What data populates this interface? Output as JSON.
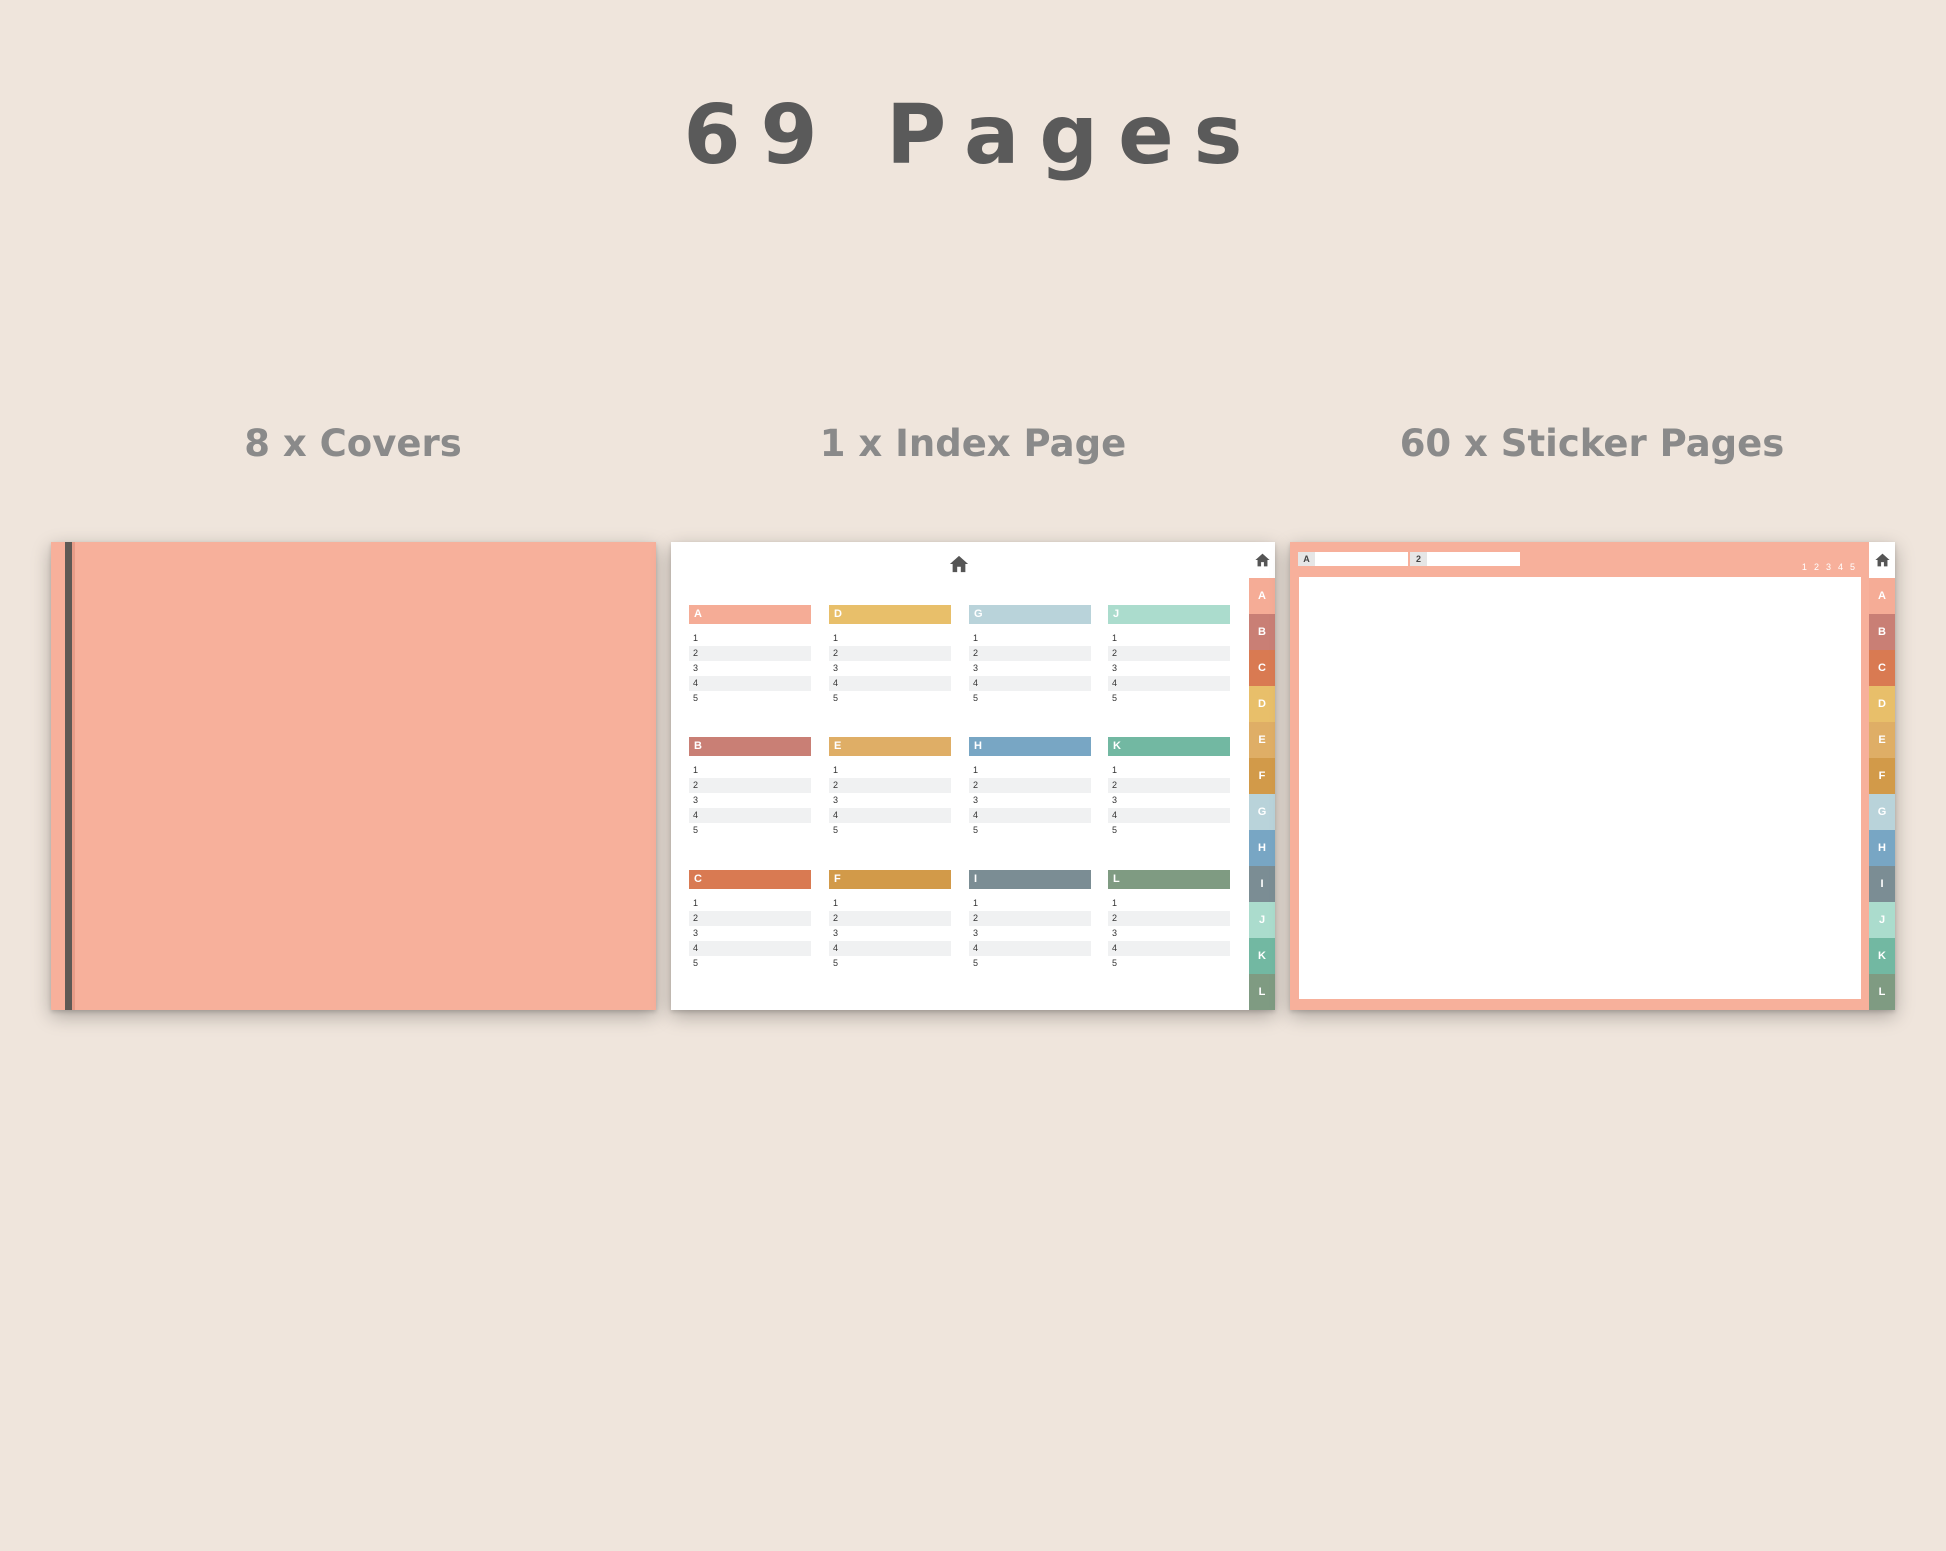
{
  "title": "69 Pages",
  "captions": {
    "covers": "8 x Covers",
    "index": "1 x Index Page",
    "stickers": "60 x Sticker Pages"
  },
  "colors": {
    "background": "#efe5dc",
    "cover": "#f7b09b",
    "row_shade": "#f0f1f2"
  },
  "icons": {
    "home": "home-icon"
  },
  "tabs": [
    {
      "label": "A",
      "color": "#f5ac96"
    },
    {
      "label": "B",
      "color": "#c97f75"
    },
    {
      "label": "C",
      "color": "#d97a52"
    },
    {
      "label": "D",
      "color": "#e8bf6a"
    },
    {
      "label": "E",
      "color": "#dfae66"
    },
    {
      "label": "F",
      "color": "#d29a49"
    },
    {
      "label": "G",
      "color": "#b9d3da"
    },
    {
      "label": "H",
      "color": "#78a6c4"
    },
    {
      "label": "I",
      "color": "#7b8d94"
    },
    {
      "label": "J",
      "color": "#abdccd"
    },
    {
      "label": "K",
      "color": "#72b8a2"
    },
    {
      "label": "L",
      "color": "#7f9b82"
    }
  ],
  "index": {
    "row_numbers": [
      "1",
      "2",
      "3",
      "4",
      "5"
    ]
  },
  "sticker": {
    "field_keys": [
      "A",
      "2"
    ],
    "page_numbers": [
      "1",
      "2",
      "3",
      "4",
      "5"
    ]
  }
}
